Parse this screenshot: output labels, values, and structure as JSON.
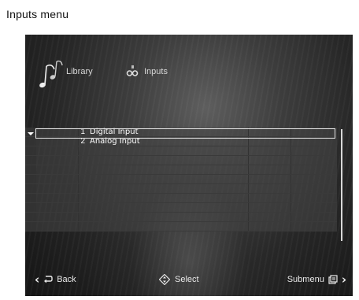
{
  "caption": "Inputs menu",
  "header": {
    "tabs": [
      {
        "label": "Library",
        "icon": "music-note-icon"
      },
      {
        "label": "Inputs",
        "icon": "inputs-icon"
      }
    ]
  },
  "list": {
    "selected_index": 0,
    "items": [
      {
        "number": "1",
        "label": "Digital Input"
      },
      {
        "number": "2",
        "label": "Analog Input"
      }
    ],
    "empty_rows": 9
  },
  "footer": {
    "back_label": "Back",
    "select_label": "Select",
    "submenu_label": "Submenu"
  }
}
